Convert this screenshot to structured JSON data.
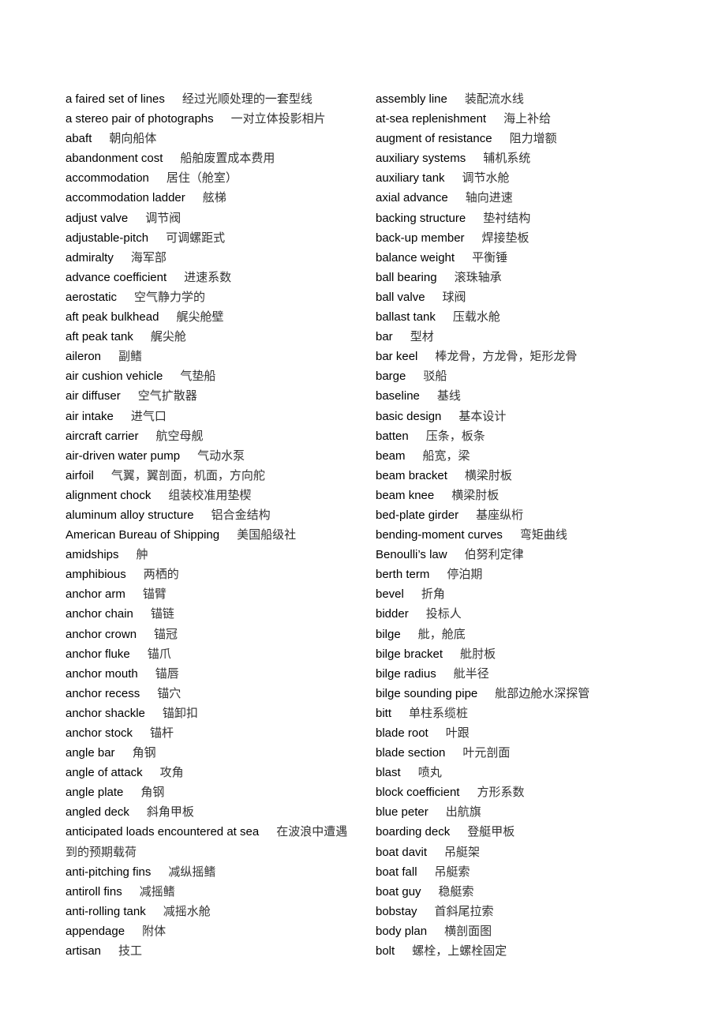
{
  "document": {
    "left_column": [
      {
        "en": "a faired set of lines",
        "zh": "经过光顺处理的一套型线"
      },
      {
        "en": "a stereo pair of photographs",
        "zh": "一对立体投影相片"
      },
      {
        "en": "abaft",
        "zh": "朝向船体"
      },
      {
        "en": "abandonment cost",
        "zh": "船舶废置成本费用"
      },
      {
        "en": "accommodation",
        "zh": "居住（舱室）"
      },
      {
        "en": "accommodation ladder",
        "zh": "舷梯"
      },
      {
        "en": "adjust valve",
        "zh": "调节阀"
      },
      {
        "en": "adjustable-pitch",
        "zh": "可调螺距式"
      },
      {
        "en": "admiralty",
        "zh": "海军部"
      },
      {
        "en": "advance coefficient",
        "zh": "进速系数"
      },
      {
        "en": "aerostatic",
        "zh": "空气静力学的"
      },
      {
        "en": "aft peak bulkhead",
        "zh": "艉尖舱壁"
      },
      {
        "en": "aft peak tank",
        "zh": "艉尖舱"
      },
      {
        "en": "aileron",
        "zh": "副鳍"
      },
      {
        "en": "air cushion vehicle",
        "zh": "气垫船"
      },
      {
        "en": "air diffuser",
        "zh": "空气扩散器"
      },
      {
        "en": "air intake",
        "zh": "进气口"
      },
      {
        "en": "aircraft carrier",
        "zh": "航空母舰"
      },
      {
        "en": "air-driven water pump",
        "zh": "气动水泵"
      },
      {
        "en": "airfoil",
        "zh": "气翼，翼剖面，机面，方向舵"
      },
      {
        "en": "alignment chock",
        "zh": "组装校准用垫楔"
      },
      {
        "en": "aluminum alloy structure",
        "zh": "铝合金结构"
      },
      {
        "en": "American Bureau of Shipping",
        "zh": "美国船级社"
      },
      {
        "en": "amidships",
        "zh": "舯"
      },
      {
        "en": "amphibious",
        "zh": "两栖的"
      },
      {
        "en": "anchor arm",
        "zh": "锚臂"
      },
      {
        "en": "anchor chain",
        "zh": "锚链"
      },
      {
        "en": "anchor crown",
        "zh": "锚冠"
      },
      {
        "en": "anchor fluke",
        "zh": "锚爪"
      },
      {
        "en": "anchor mouth",
        "zh": "锚唇"
      },
      {
        "en": "anchor recess",
        "zh": "锚穴"
      },
      {
        "en": "anchor shackle",
        "zh": "锚卸扣"
      },
      {
        "en": "anchor stock",
        "zh": "锚杆"
      },
      {
        "en": "angle bar",
        "zh": "角钢"
      },
      {
        "en": "angle of attack",
        "zh": "攻角"
      },
      {
        "en": "angle plate",
        "zh": "角钢"
      },
      {
        "en": "angled deck",
        "zh": "斜角甲板"
      },
      {
        "en": "anticipated loads encountered at sea",
        "zh": "在波浪中遭遇到的预期载荷"
      },
      {
        "en": "anti-pitching fins",
        "zh": "减纵摇鳍"
      },
      {
        "en": "antiroll fins",
        "zh": "减摇鳍"
      },
      {
        "en": "anti-rolling tank",
        "zh": "减摇水舱"
      },
      {
        "en": "appendage",
        "zh": "附体"
      },
      {
        "en": "artisan",
        "zh": "技工"
      }
    ],
    "right_column": [
      {
        "en": "assembly line",
        "zh": "装配流水线"
      },
      {
        "en": "at-sea replenishment",
        "zh": "海上补给"
      },
      {
        "en": "augment of resistance",
        "zh": "阻力增额"
      },
      {
        "en": "auxiliary systems",
        "zh": "辅机系统"
      },
      {
        "en": "auxiliary tank",
        "zh": "调节水舱"
      },
      {
        "en": "axial advance",
        "zh": "轴向进速"
      },
      {
        "en": "backing structure",
        "zh": "垫衬结构"
      },
      {
        "en": "back-up member",
        "zh": "焊接垫板"
      },
      {
        "en": "balance weight",
        "zh": "平衡锤"
      },
      {
        "en": "ball bearing",
        "zh": "滚珠轴承"
      },
      {
        "en": "ball valve",
        "zh": "球阀"
      },
      {
        "en": "ballast tank",
        "zh": "压载水舱"
      },
      {
        "en": "bar",
        "zh": "型材"
      },
      {
        "en": "bar keel",
        "zh": "棒龙骨，方龙骨，矩形龙骨"
      },
      {
        "en": "barge",
        "zh": "驳船"
      },
      {
        "en": "baseline",
        "zh": "基线"
      },
      {
        "en": "basic design",
        "zh": "基本设计"
      },
      {
        "en": "batten",
        "zh": "压条，板条"
      },
      {
        "en": "beam",
        "zh": "船宽，梁"
      },
      {
        "en": "beam bracket",
        "zh": "横梁肘板"
      },
      {
        "en": "beam knee",
        "zh": "横梁肘板"
      },
      {
        "en": "bed-plate girder",
        "zh": "基座纵桁"
      },
      {
        "en": "bending-moment curves",
        "zh": "弯矩曲线"
      },
      {
        "en": "Benoulli’s law",
        "zh": "伯努利定律"
      },
      {
        "en": "berth term",
        "zh": "停泊期"
      },
      {
        "en": "bevel",
        "zh": "折角"
      },
      {
        "en": "bidder",
        "zh": "投标人"
      },
      {
        "en": "bilge",
        "zh": "舭，舱底"
      },
      {
        "en": "bilge bracket",
        "zh": "舭肘板"
      },
      {
        "en": "bilge radius",
        "zh": "舭半径"
      },
      {
        "en": "bilge sounding pipe",
        "zh": "舭部边舱水深探管"
      },
      {
        "en": "bitt",
        "zh": "单柱系缆桩"
      },
      {
        "en": "blade root",
        "zh": "叶跟"
      },
      {
        "en": "blade section",
        "zh": "叶元剖面"
      },
      {
        "en": "blast",
        "zh": "喷丸"
      },
      {
        "en": "block coefficient",
        "zh": "方形系数"
      },
      {
        "en": "blue peter",
        "zh": "出航旗"
      },
      {
        "en": "boarding deck",
        "zh": "登艇甲板"
      },
      {
        "en": "boat davit",
        "zh": "吊艇架"
      },
      {
        "en": "boat fall",
        "zh": "吊艇索"
      },
      {
        "en": "boat guy",
        "zh": "稳艇索"
      },
      {
        "en": "bobstay",
        "zh": "首斜尾拉索"
      },
      {
        "en": "body plan",
        "zh": "横剖面图"
      },
      {
        "en": "bolt",
        "zh": "螺栓，上螺栓固定"
      }
    ]
  }
}
